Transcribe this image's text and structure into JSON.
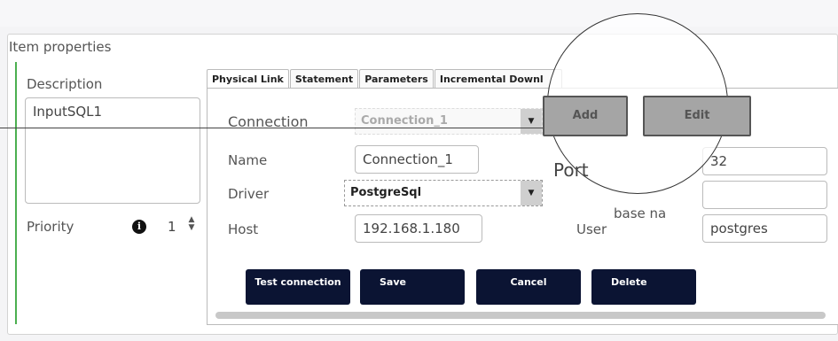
{
  "panel": {
    "title": "Item properties"
  },
  "left": {
    "description_label": "Description",
    "description_value": "InputSQL1",
    "priority_label": "Priority",
    "info_icon": "info-icon",
    "priority_value": "1",
    "stepper_up": "▲",
    "stepper_down": "▼"
  },
  "tabs": [
    "Physical Link",
    "Statement",
    "Parameters",
    "Incremental Downl"
  ],
  "form": {
    "connection_label": "Connection",
    "connection_value": "Connection_1",
    "add_label": "Add",
    "edit_label": "Edit",
    "name_label": "Name",
    "name_value": "Connection_1",
    "port_label": "Port",
    "port_value": "32",
    "driver_label": "Driver",
    "driver_value": "PostgreSql",
    "database_label_fragment": "base na",
    "database_value": "",
    "host_label": "Host",
    "host_value": "192.168.1.180",
    "user_label": "User",
    "user_value": "postgres",
    "dropdown_arrow": "▼"
  },
  "buttons": {
    "test_connection": "Test connection",
    "save": "Save",
    "cancel": "Cancel",
    "delete": "Delete"
  }
}
